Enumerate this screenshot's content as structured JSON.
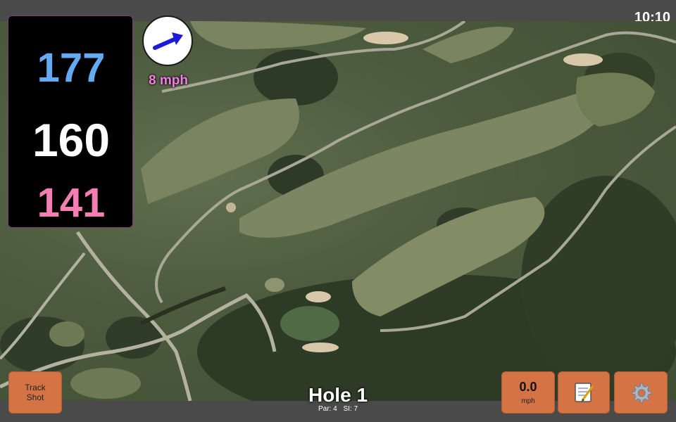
{
  "status_bar": {
    "time": "10:10"
  },
  "distances": {
    "back": "177",
    "center": "160",
    "front": "141"
  },
  "wind": {
    "speed": "8 mph",
    "icon": "wind-arrow-icon"
  },
  "buttons": {
    "track_shot_line1": "Track",
    "track_shot_line2": "Shot",
    "speed_value": "0.0",
    "speed_unit": "mph",
    "notes_icon": "notepad-icon",
    "settings_icon": "gear-icon"
  },
  "hole": {
    "title": "Hole 1",
    "par": "Par: 4",
    "si": "SI: 7"
  },
  "colors": {
    "back_distance": "#64aaf0",
    "center_distance": "#ffffff",
    "front_distance": "#f27eb4",
    "wind_text": "#f27ee0",
    "button_bg": "#d47445"
  }
}
